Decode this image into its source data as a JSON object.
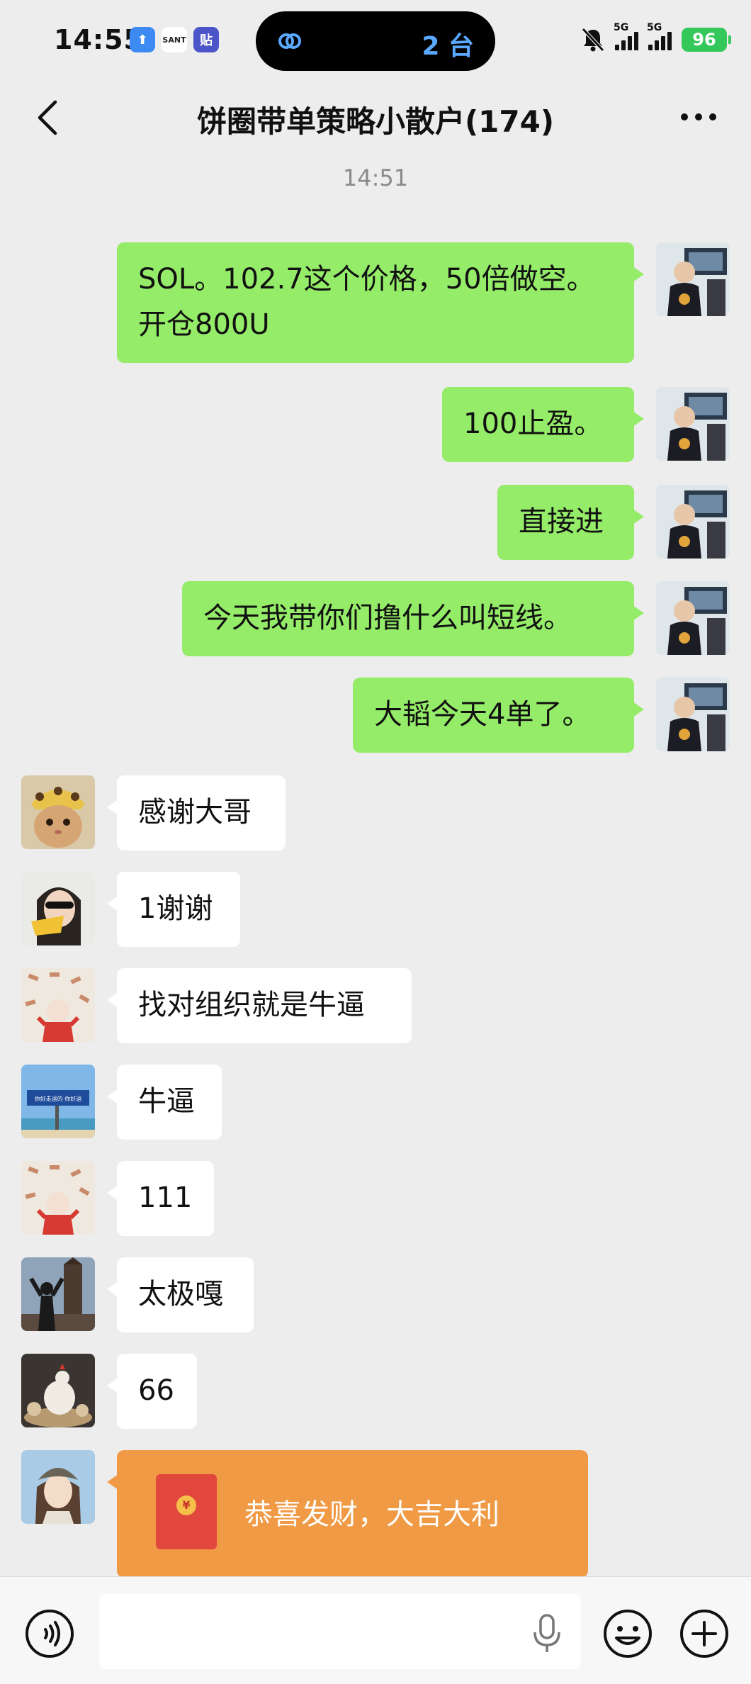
{
  "status_bar": {
    "time": "14:55",
    "island_text": "2 台",
    "signal1_label": "5G",
    "signal2_label": "5G",
    "battery": "96"
  },
  "nav": {
    "title": "饼圈带单策略小散户(174)"
  },
  "chat": {
    "timestamp": "14:51",
    "outgoing": [
      {
        "text": "SOL。102.7这个价格，50倍做空。开仓800U"
      },
      {
        "text": "100止盈。"
      },
      {
        "text": "直接进"
      },
      {
        "text": "今天我带你们撸什么叫短线。"
      },
      {
        "text": "大韬今天4单了。"
      }
    ],
    "incoming": [
      {
        "text": "感谢大哥"
      },
      {
        "text": "1谢谢"
      },
      {
        "text": "找对组织就是牛逼"
      },
      {
        "text": "牛逼"
      },
      {
        "text": "111"
      },
      {
        "text": "太极嘎"
      },
      {
        "text": "66"
      }
    ],
    "red_packet": {
      "text": "恭喜发财，大吉大利",
      "coin_symbol": "¥"
    },
    "sign_text": "你好走运的 你好运"
  },
  "colors": {
    "outgoing_bubble": "#95ec69",
    "incoming_bubble": "#ffffff",
    "red_packet": "#f09a45",
    "background": "#ededed"
  }
}
